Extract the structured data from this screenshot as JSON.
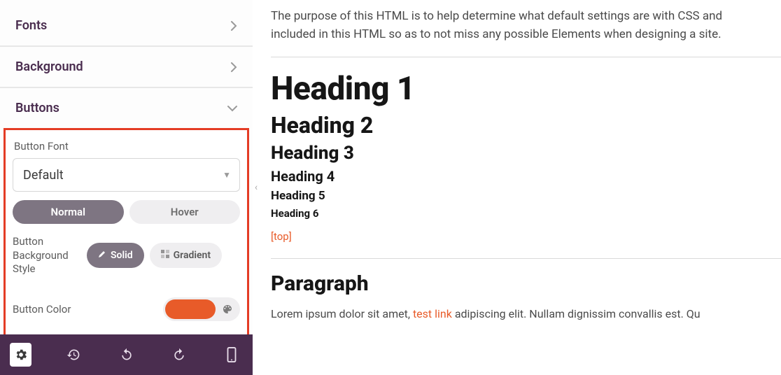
{
  "sidebar": {
    "sections": {
      "fonts": "Fonts",
      "background": "Background",
      "buttons": "Buttons"
    },
    "buttonsPanel": {
      "fontLabel": "Button Font",
      "fontValue": "Default",
      "stateTabs": {
        "normal": "Normal",
        "hover": "Hover"
      },
      "bgStyleLabel": "Button Background Style",
      "bgStyle": {
        "solid": "Solid",
        "gradient": "Gradient"
      },
      "colorLabel": "Button Color",
      "colorValue": "#e85b29"
    }
  },
  "preview": {
    "intro1": "The purpose of this HTML is to help determine what default settings are with CSS and",
    "intro2": "included in this HTML so as to not miss any possible Elements when designing a site.",
    "h1": "Heading 1",
    "h2": "Heading 2",
    "h3": "Heading 3",
    "h4": "Heading 4",
    "h5": "Heading 5",
    "h6": "Heading 6",
    "topLink": "[top]",
    "paragraphHeading": "Paragraph",
    "loremPre": "Lorem ipsum dolor sit amet, ",
    "testLink": "test link",
    "loremPost": " adipiscing elit. Nullam dignissim convallis est. Qu"
  }
}
